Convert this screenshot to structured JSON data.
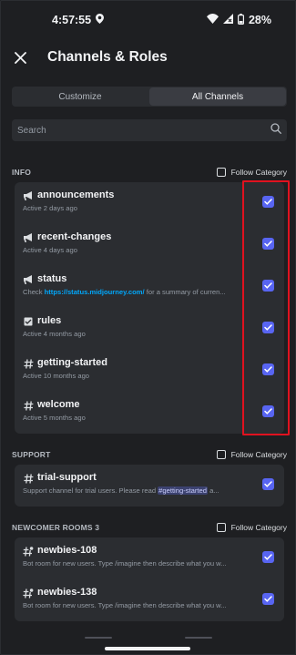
{
  "status_bar": {
    "time": "4:57:55",
    "battery": "28%"
  },
  "header": {
    "title": "Channels & Roles"
  },
  "tabs": [
    {
      "label": "Customize"
    },
    {
      "label": "All Channels"
    }
  ],
  "search": {
    "placeholder": "Search"
  },
  "follow_label": "Follow Category",
  "sections": [
    {
      "title": "INFO",
      "channels": [
        {
          "name": "announcements",
          "sub": "Active 2 days ago",
          "icon": "megaphone-icon",
          "checked": true
        },
        {
          "name": "recent-changes",
          "sub": "Active 4 days ago",
          "icon": "megaphone-icon",
          "checked": true
        },
        {
          "name": "status",
          "sub_prefix": "Check ",
          "sub_link": "https://status.midjourney.com/",
          "sub_suffix": " for a summary of curren...",
          "icon": "megaphone-icon",
          "checked": true
        },
        {
          "name": "rules",
          "sub": "Active 4 months ago",
          "icon": "rules-icon",
          "checked": true
        },
        {
          "name": "getting-started",
          "sub": "Active 10 months ago",
          "icon": "hash-icon",
          "checked": true
        },
        {
          "name": "welcome",
          "sub": "Active 5 months ago",
          "icon": "hash-icon",
          "checked": true
        }
      ]
    },
    {
      "title": "SUPPORT",
      "channels": [
        {
          "name": "trial-support",
          "sub_prefix": "Support channel for trial users. Please read ",
          "sub_mention": "#getting-started",
          "sub_suffix": " a...",
          "icon": "hash-icon",
          "checked": true
        }
      ]
    },
    {
      "title": "NEWCOMER ROOMS 3",
      "channels": [
        {
          "name": "newbies-108",
          "sub": "Bot room for new users. Type /imagine then describe what you w...",
          "icon": "hash-thread-icon",
          "checked": true
        },
        {
          "name": "newbies-138",
          "sub": "Bot room for new users. Type /imagine then describe what you w...",
          "icon": "hash-thread-icon",
          "checked": true
        }
      ]
    }
  ],
  "colors": {
    "accent": "#5865f2",
    "highlight": "#e0121f",
    "link": "#00a8fc"
  }
}
